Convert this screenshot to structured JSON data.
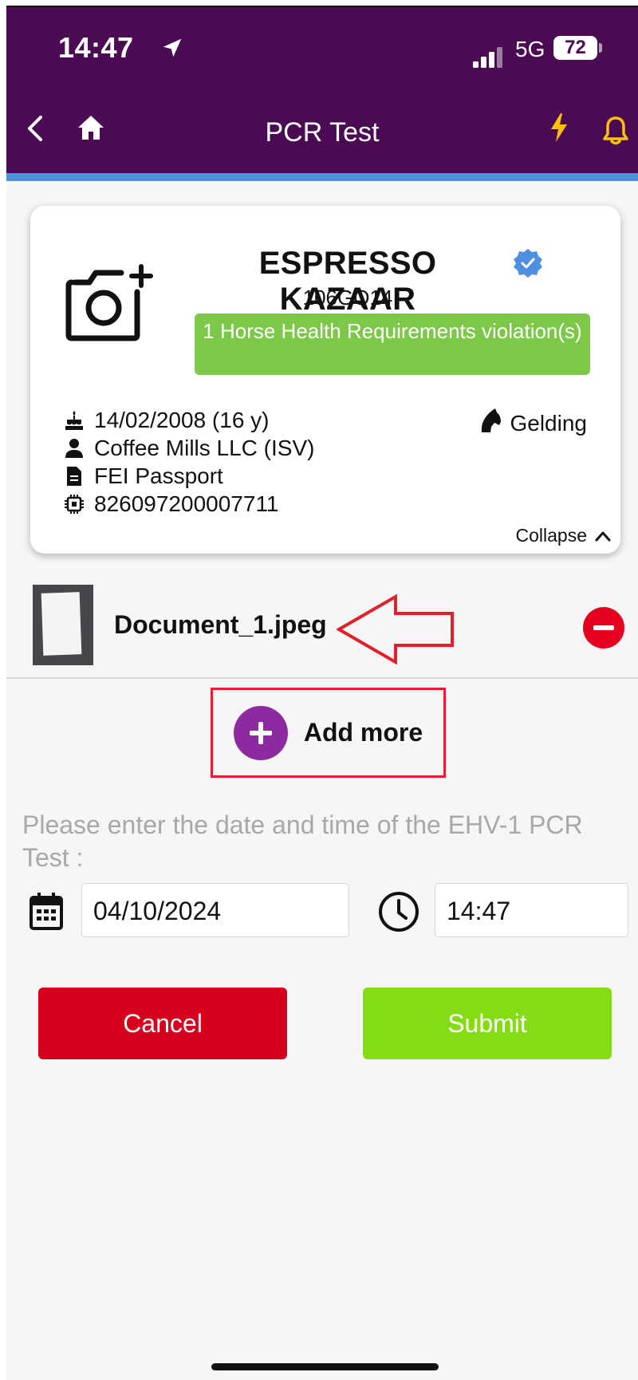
{
  "status_bar": {
    "time": "14:47",
    "network": "5G",
    "battery": "72"
  },
  "nav": {
    "title": "PCR Test"
  },
  "horse": {
    "name": "ESPRESSO KAZAAR",
    "id": "106GQ14",
    "violation": "1 Horse Health Requirements violation(s)",
    "birth": "14/02/2008 (16 y)",
    "owner": "Coffee Mills LLC (ISV)",
    "passport": "FEI Passport",
    "chip": "826097200007711",
    "gender": "Gelding",
    "collapse_label": "Collapse"
  },
  "documents": [
    {
      "name": "Document_1.jpeg"
    }
  ],
  "add_more_label": "Add more",
  "form": {
    "prompt": "Please enter the date and time of the EHV-1 PCR Test :",
    "date": "04/10/2024",
    "time": "14:47"
  },
  "actions": {
    "cancel": "Cancel",
    "submit": "Submit"
  },
  "colors": {
    "header": "#4a0b52",
    "accent_bar": "#4f8fe0",
    "violation_badge": "#7dc74a",
    "cancel": "#d6001c",
    "submit": "#84dc12",
    "add_button": "#8e2aa0",
    "annotation": "#e0202c",
    "icon_yellow": "#ffc107"
  },
  "icons": {
    "back": "chevron-left-icon",
    "home": "home-icon",
    "bolt": "lightning-icon",
    "bell": "bell-icon",
    "camera": "camera-add-icon",
    "verified": "verified-badge-icon",
    "cake": "cake-icon",
    "person": "person-icon",
    "document": "document-icon",
    "chip": "chip-icon",
    "horse": "horse-head-icon",
    "remove": "remove-icon",
    "add": "plus-icon",
    "calendar": "calendar-icon",
    "clock": "clock-icon"
  }
}
